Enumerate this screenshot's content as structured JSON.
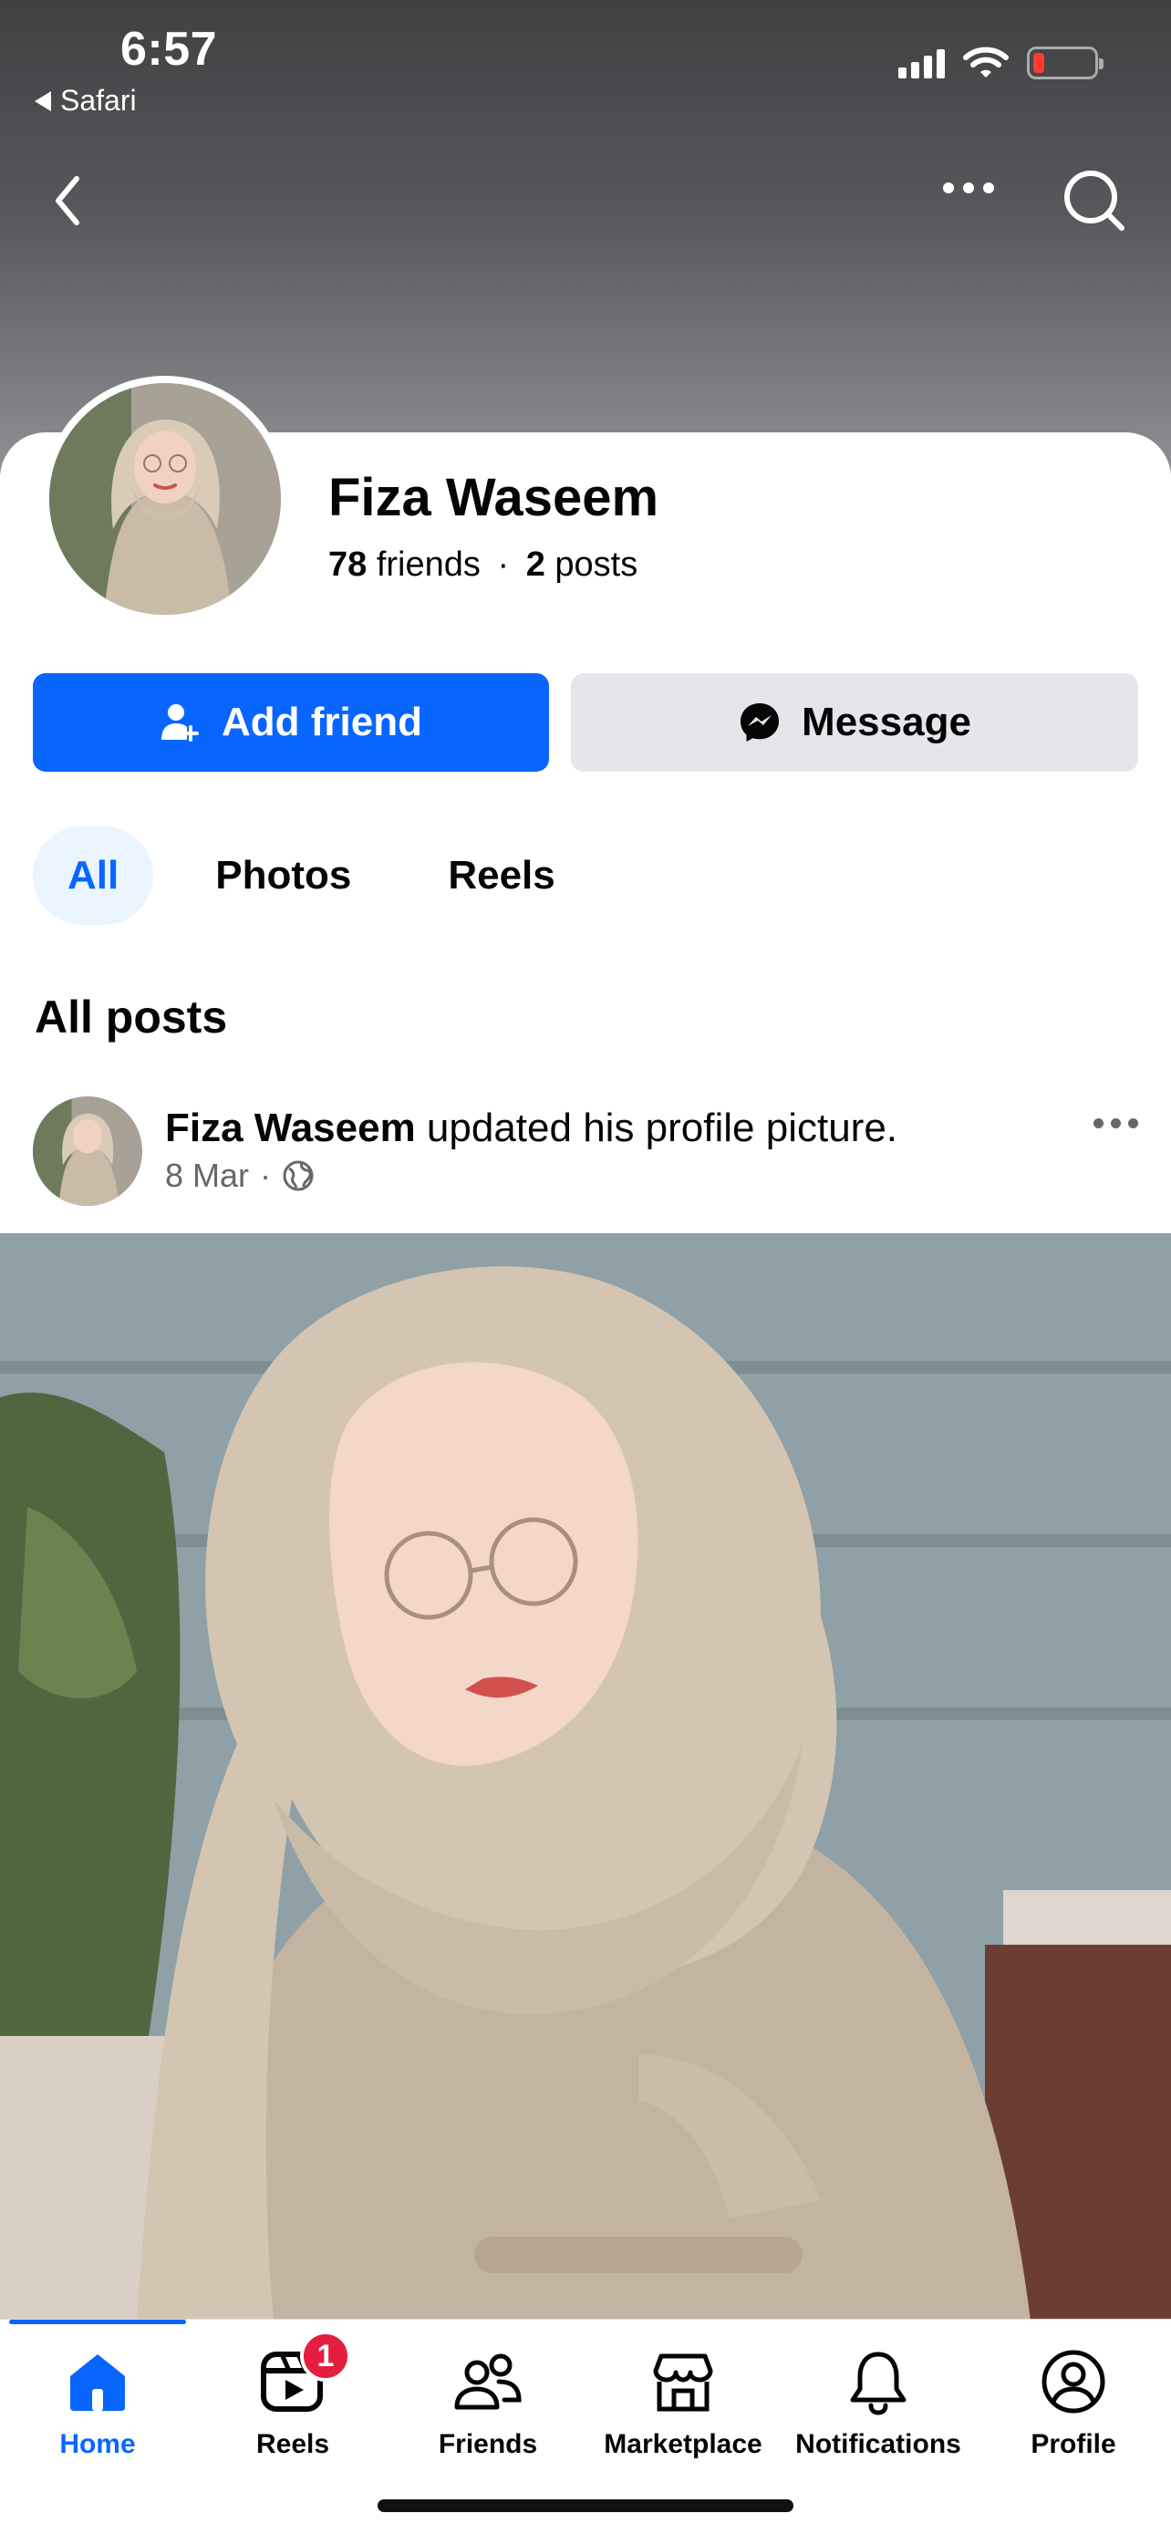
{
  "status_bar": {
    "time": "6:57",
    "back_app": "Safari",
    "battery_color": "#ff3b30"
  },
  "top_nav": {
    "back_icon": "chevron-left-icon",
    "more_icon": "more-horizontal-icon",
    "search_icon": "search-icon"
  },
  "profile": {
    "name": "Fiza Waseem",
    "friends_count": "78",
    "friends_label": "friends",
    "separator": "·",
    "posts_count": "2",
    "posts_label": "posts"
  },
  "actions": {
    "add_friend": "Add friend",
    "message": "Message",
    "primary_color": "#0866ff"
  },
  "tabs": [
    {
      "label": "All",
      "active": true
    },
    {
      "label": "Photos",
      "active": false
    },
    {
      "label": "Reels",
      "active": false
    }
  ],
  "section_title": "All posts",
  "post": {
    "author": "Fiza Waseem",
    "action_text": " updated his profile picture.",
    "date": "8 Mar",
    "meta_separator": "·",
    "audience_icon": "globe-icon"
  },
  "bottom_nav": [
    {
      "label": "Home",
      "icon": "home-icon",
      "active": true
    },
    {
      "label": "Reels",
      "icon": "reels-icon",
      "badge": "1"
    },
    {
      "label": "Friends",
      "icon": "friends-icon"
    },
    {
      "label": "Marketplace",
      "icon": "marketplace-icon"
    },
    {
      "label": "Notifications",
      "icon": "bell-icon"
    },
    {
      "label": "Profile",
      "icon": "profile-icon"
    }
  ]
}
